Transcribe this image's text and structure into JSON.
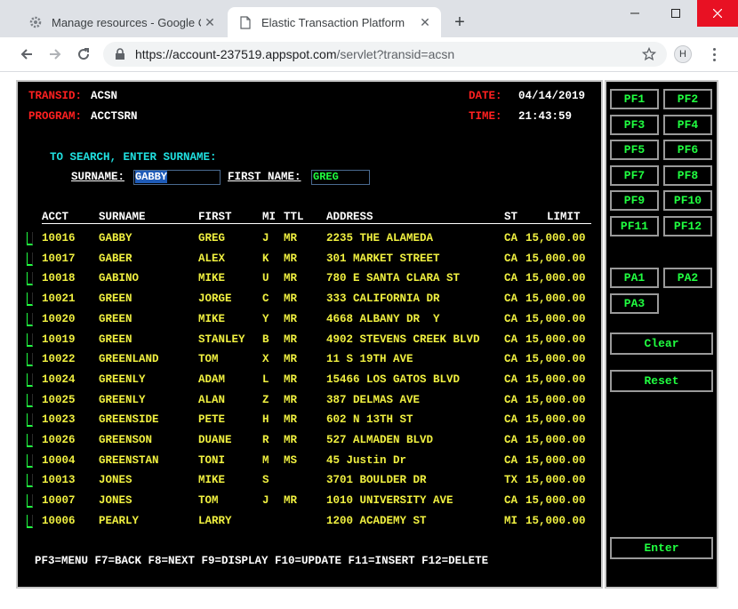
{
  "browser": {
    "tabs": [
      {
        "title": "Manage resources - Google Clou",
        "active": false
      },
      {
        "title": "Elastic Transaction Platform",
        "active": true
      }
    ],
    "new_tab": "+",
    "url_host": "https://account-237519.appspot.com",
    "url_path": "/servlet?transid=acsn",
    "avatar_initial": "H"
  },
  "terminal": {
    "transid_label": "TRANSID:",
    "transid_value": "ACSN",
    "program_label": "PROGRAM:",
    "program_value": "ACCTSRN",
    "date_label": "DATE:",
    "date_value": "04/14/2019",
    "time_label": "TIME:",
    "time_value": "21:43:59",
    "instruction": "TO SEARCH, ENTER SURNAME:",
    "surname_label": "SURNAME:",
    "surname_value": "GABBY",
    "first_name_label": "FIRST NAME:",
    "first_name_value": "GREG",
    "columns": {
      "acct": "ACCT",
      "surname": "SURNAME",
      "first": "FIRST",
      "mi": "MI",
      "ttl": "TTL",
      "address": "ADDRESS",
      "st": "ST",
      "limit": "LIMIT"
    },
    "rows": [
      {
        "acct": "10016",
        "surname": "GABBY",
        "first": "GREG",
        "mi": "J",
        "ttl": "MR",
        "address": "2235 THE ALAMEDA",
        "st": "CA",
        "limit": "15,000.00"
      },
      {
        "acct": "10017",
        "surname": "GABER",
        "first": "ALEX",
        "mi": "K",
        "ttl": "MR",
        "address": "301 MARKET STREET",
        "st": "CA",
        "limit": "15,000.00"
      },
      {
        "acct": "10018",
        "surname": "GABINO",
        "first": "MIKE",
        "mi": "U",
        "ttl": "MR",
        "address": "780 E SANTA CLARA ST",
        "st": "CA",
        "limit": "15,000.00"
      },
      {
        "acct": "10021",
        "surname": "GREEN",
        "first": "JORGE",
        "mi": "C",
        "ttl": "MR",
        "address": "333 CALIFORNIA DR",
        "st": "CA",
        "limit": "15,000.00"
      },
      {
        "acct": "10020",
        "surname": "GREEN",
        "first": "MIKE",
        "mi": "Y",
        "ttl": "MR",
        "address": "4668 ALBANY DR  Y",
        "st": "CA",
        "limit": "15,000.00"
      },
      {
        "acct": "10019",
        "surname": "GREEN",
        "first": "STANLEY",
        "mi": "B",
        "ttl": "MR",
        "address": "4902 STEVENS CREEK BLVD",
        "st": "CA",
        "limit": "15,000.00"
      },
      {
        "acct": "10022",
        "surname": "GREENLAND",
        "first": "TOM",
        "mi": "X",
        "ttl": "MR",
        "address": "11 S 19TH AVE",
        "st": "CA",
        "limit": "15,000.00"
      },
      {
        "acct": "10024",
        "surname": "GREENLY",
        "first": "ADAM",
        "mi": "L",
        "ttl": "MR",
        "address": "15466 LOS GATOS BLVD",
        "st": "CA",
        "limit": "15,000.00"
      },
      {
        "acct": "10025",
        "surname": "GREENLY",
        "first": "ALAN",
        "mi": "Z",
        "ttl": "MR",
        "address": "387 DELMAS AVE",
        "st": "CA",
        "limit": "15,000.00"
      },
      {
        "acct": "10023",
        "surname": "GREENSIDE",
        "first": "PETE",
        "mi": "H",
        "ttl": "MR",
        "address": "602 N 13TH ST",
        "st": "CA",
        "limit": "15,000.00"
      },
      {
        "acct": "10026",
        "surname": "GREENSON",
        "first": "DUANE",
        "mi": "R",
        "ttl": "MR",
        "address": "527 ALMADEN BLVD",
        "st": "CA",
        "limit": "15,000.00"
      },
      {
        "acct": "10004",
        "surname": "GREENSTAN",
        "first": "TONI",
        "mi": "M",
        "ttl": "MS",
        "address": "45 Justin Dr",
        "st": "CA",
        "limit": "15,000.00"
      },
      {
        "acct": "10013",
        "surname": "JONES",
        "first": "MIKE",
        "mi": "S",
        "ttl": "",
        "address": "3701 BOULDER DR",
        "st": "TX",
        "limit": "15,000.00"
      },
      {
        "acct": "10007",
        "surname": "JONES",
        "first": "TOM",
        "mi": "J",
        "ttl": "MR",
        "address": "1010 UNIVERSITY AVE",
        "st": "CA",
        "limit": "15,000.00"
      },
      {
        "acct": "10006",
        "surname": "PEARLY",
        "first": "LARRY",
        "mi": "",
        "ttl": "",
        "address": "1200 ACADEMY ST",
        "st": "MI",
        "limit": "15,000.00"
      }
    ],
    "footer": "PF3=MENU F7=BACK F8=NEXT F9=DISPLAY F10=UPDATE F11=INSERT F12=DELETE"
  },
  "keys": {
    "pf": [
      "PF1",
      "PF2",
      "PF3",
      "PF4",
      "PF5",
      "PF6",
      "PF7",
      "PF8",
      "PF9",
      "PF10",
      "PF11",
      "PF12"
    ],
    "pa": [
      "PA1",
      "PA2",
      "PA3"
    ],
    "clear": "Clear",
    "reset": "Reset",
    "enter": "Enter"
  },
  "colors": {
    "label_red": "#ff2020",
    "value_white": "#ffffff",
    "prompt_cyan": "#20e0e0",
    "data_yellow": "#f0f040",
    "key_green": "#20ff40"
  }
}
